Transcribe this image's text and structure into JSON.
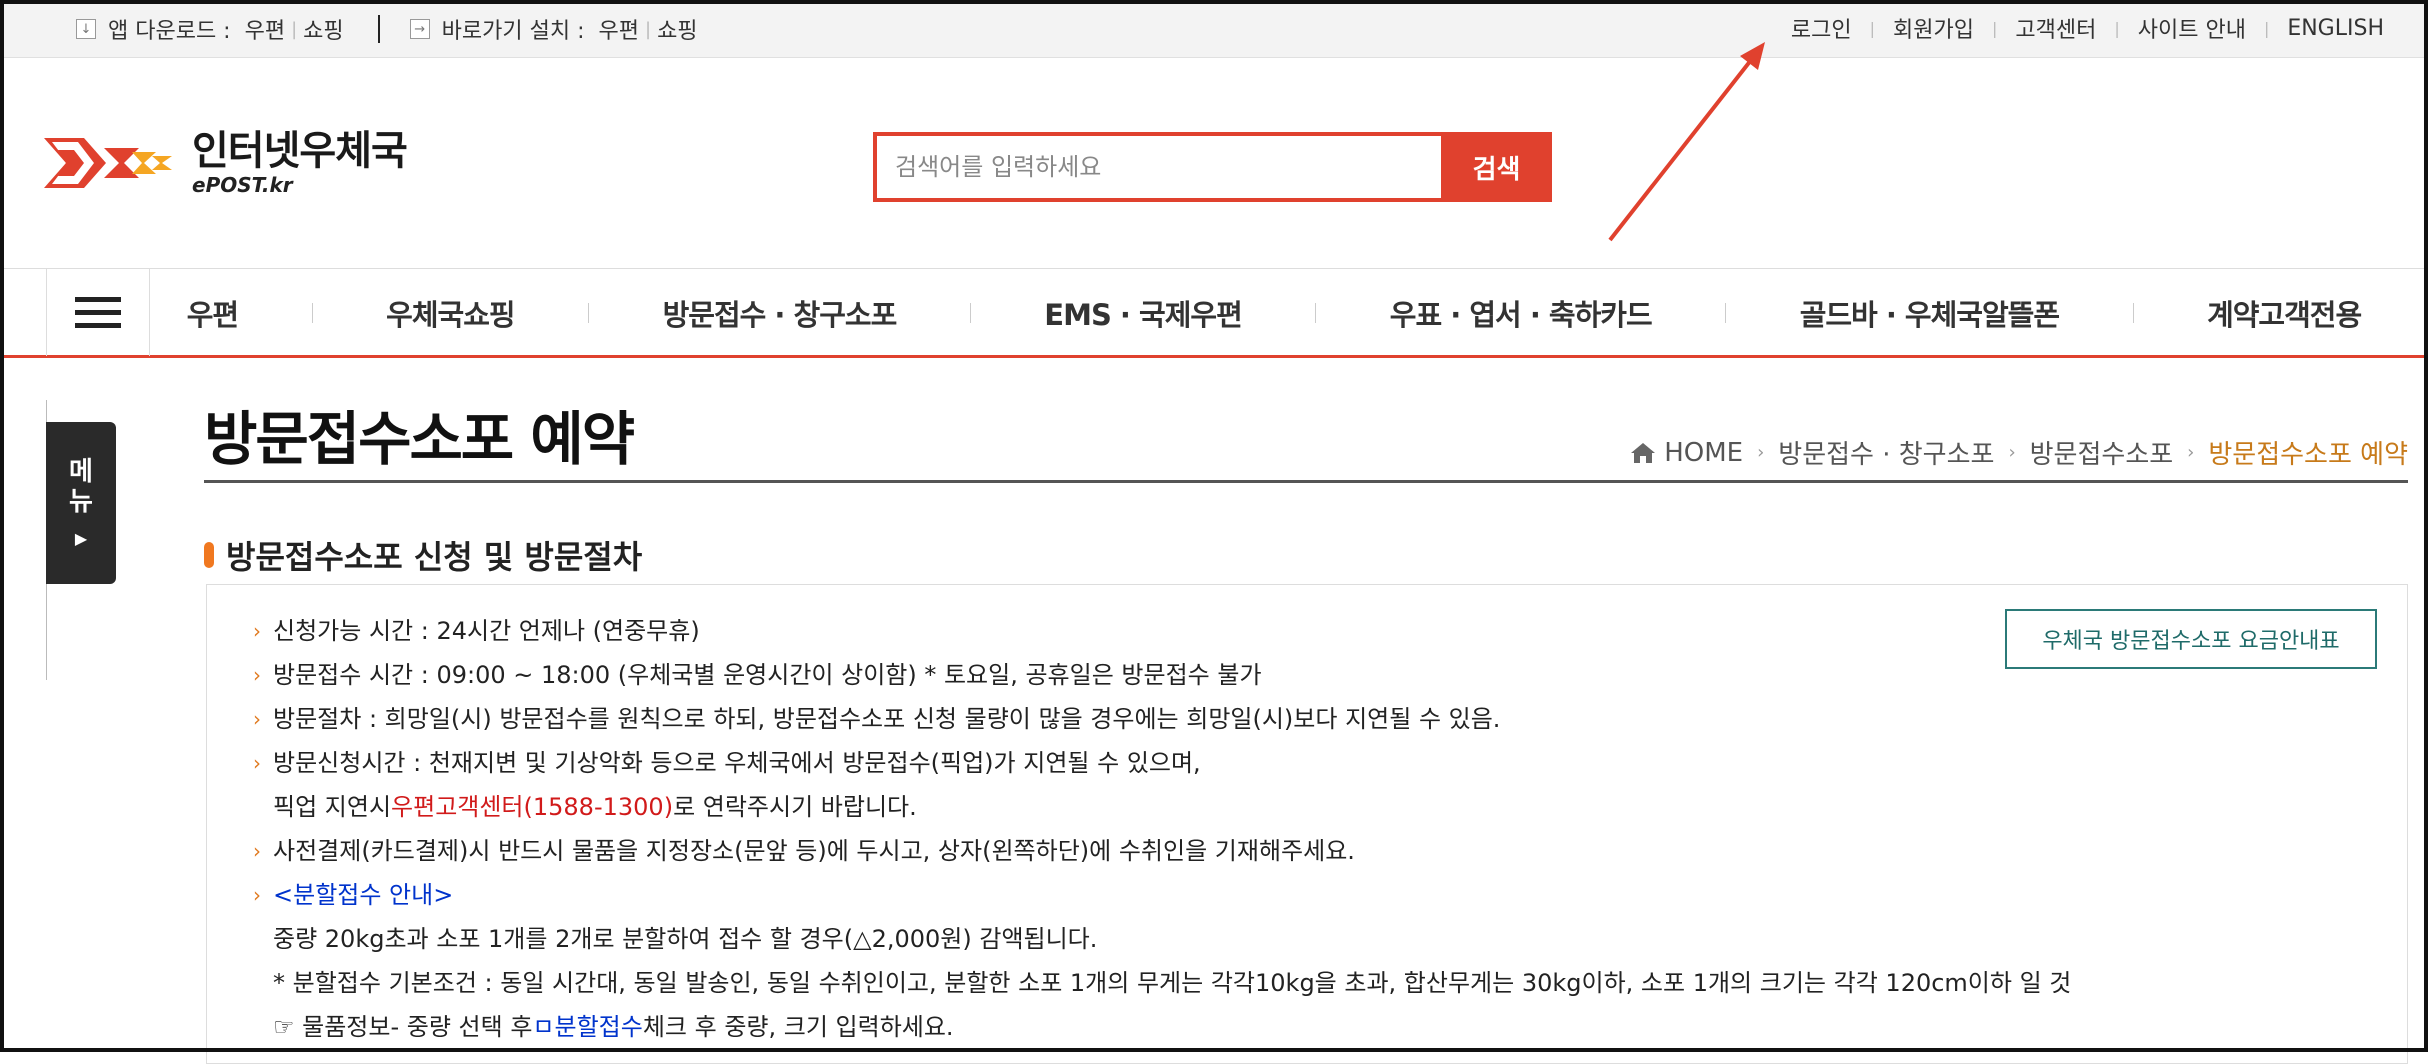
{
  "topbar": {
    "app_download_label": "앱 다운로드 :",
    "app_download_links": [
      "우편",
      "쇼핑"
    ],
    "shortcut_label": "바로가기 설치 :",
    "shortcut_links": [
      "우편",
      "쇼핑"
    ],
    "right_links": [
      "로그인",
      "회원가입",
      "고객센터",
      "사이트 안내",
      "ENGLISH"
    ]
  },
  "logo": {
    "main": "인터넷우체국",
    "sub": "ePOST.kr"
  },
  "search": {
    "placeholder": "검색어를 입력하세요",
    "button": "검색"
  },
  "nav": {
    "items": [
      "우편",
      "우체국쇼핑",
      "방문접수 · 창구소포",
      "EMS · 국제우편",
      "우표 · 엽서 · 축하카드",
      "골드바 · 우체국알뜰폰",
      "계약고객전용"
    ]
  },
  "side_menu": {
    "label_line1": "메",
    "label_line2": "뉴"
  },
  "page": {
    "title": "방문접수소포 예약",
    "breadcrumb": [
      "HOME",
      "방문접수 · 창구소포",
      "방문접수소포",
      "방문접수소포 예약"
    ]
  },
  "section": {
    "title": "방문접수소포 신청 및 방문절차",
    "fee_button": "우체국 방문접수소포 요금안내표",
    "lines": {
      "l1": "신청가능 시간 : 24시간 언제나 (연중무휴)",
      "l2": "방문접수 시간 : 09:00 ~ 18:00 (우체국별 운영시간이 상이함) * 토요일, 공휴일은 방문접수 불가",
      "l3": "방문절차 : 희망일(시) 방문접수를 원칙으로 하되, 방문접수소포 신청 물량이 많을 경우에는 희망일(시)보다 지연될 수 있음.",
      "l4": "방문신청시간 : 천재지변 및 기상악화 등으로 우체국에서 방문접수(픽업)가 지연될 수 있으며,",
      "l5_pre": "픽업 지연시 ",
      "l5_red": "우편고객센터(1588-1300)",
      "l5_post": "로 연락주시기 바랍니다.",
      "l6": "사전결제(카드결제)시 반드시 물품을 지정장소(문앞 등)에 두시고, 상자(왼쪽하단)에 수취인을 기재해주세요.",
      "l7_blue": "<분할접수 안내>",
      "l8": "중량 20kg초과 소포 1개를 2개로 분할하여 접수 할 경우(△2,000원) 감액됩니다.",
      "l9": "* 분할접수 기본조건 : 동일 시간대, 동일 발송인, 동일 수취인이고, 분할한 소포 1개의 무게는 각각10kg을 초과, 합산무게는 30kg이하, 소포 1개의 크기는 각각 120cm이하 일 것",
      "l10_pre": "☞ 물품정보- 중량 선택 후 ",
      "l10_blue": "ㅁ분할접수",
      "l10_post": " 체크 후 중량, 크기 입력하세요."
    }
  },
  "colors": {
    "accent_red": "#e0412e",
    "breadcrumb_current": "#c77a1a",
    "bullet_orange": "#e07a20",
    "fee_button": "#2b7a78"
  }
}
